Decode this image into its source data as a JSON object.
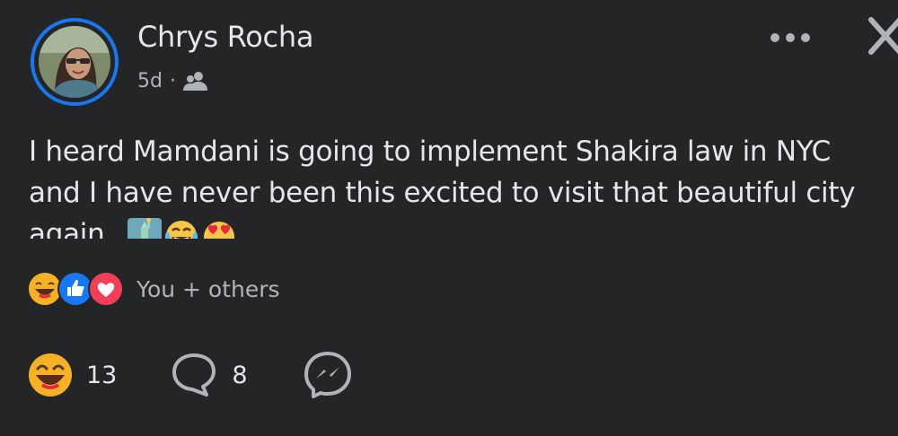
{
  "post": {
    "author_name": "Chrys Rocha",
    "timestamp": "5d",
    "separator": "·",
    "audience_icon": "friends-icon",
    "body_text": "I heard Mamdani is going to implement Shakira law in NYC and I have never been this excited to visit that beautiful city again.",
    "body_emojis": [
      "statue-of-liberty-emoji",
      "tears-of-joy-emoji",
      "heart-eyes-emoji"
    ]
  },
  "reactions": {
    "icons": [
      "haha-reaction-icon",
      "like-reaction-icon",
      "love-reaction-icon"
    ],
    "summary": "You + others"
  },
  "actions": {
    "reaction_count": "13",
    "comment_count": "8",
    "share_icon": "messenger-icon"
  },
  "header_controls": {
    "more_icon": "more-options-icon",
    "close_icon": "close-icon"
  },
  "colors": {
    "background": "#242526",
    "primary_text": "#e4e6eb",
    "secondary_text": "#b0b3b8",
    "accent": "#1877f2",
    "love": "#f33e58",
    "haha": "#f7b125"
  }
}
